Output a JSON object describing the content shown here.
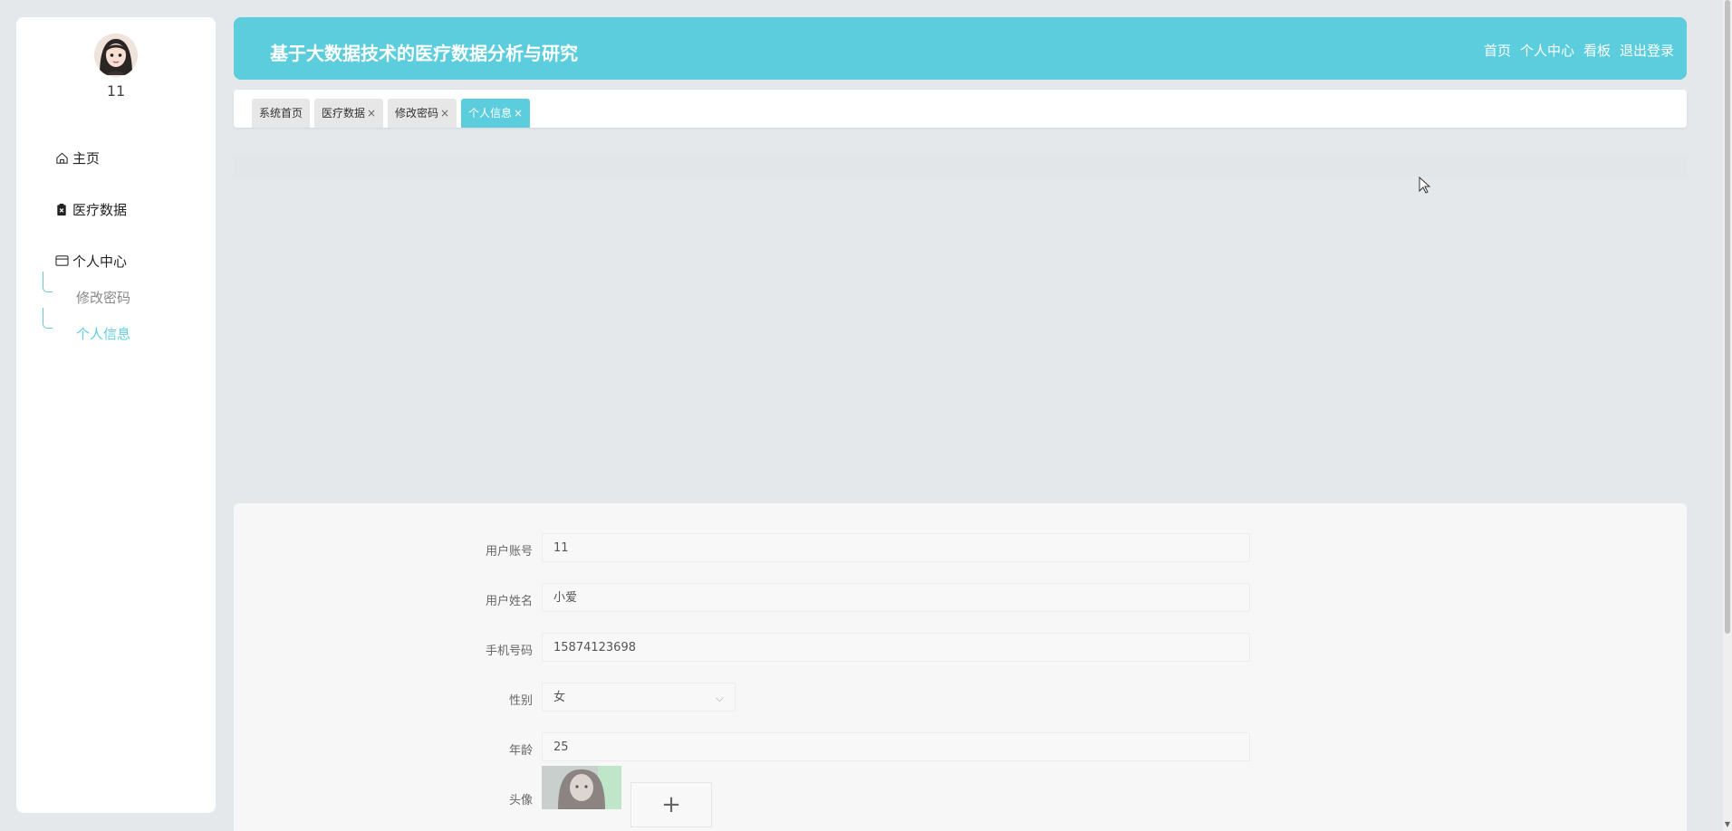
{
  "user": {
    "name": "11"
  },
  "sidebar": {
    "items": [
      {
        "label": "主页",
        "icon": "home-icon"
      },
      {
        "label": "医疗数据",
        "icon": "clipboard-icon"
      },
      {
        "label": "个人中心",
        "icon": "card-icon"
      }
    ],
    "subitems": [
      {
        "label": "修改密码"
      },
      {
        "label": "个人信息",
        "active": true
      }
    ]
  },
  "header": {
    "title": "基于大数据技术的医疗数据分析与研究",
    "nav": [
      "首页",
      "个人中心",
      "看板",
      "退出登录"
    ]
  },
  "tabs": [
    {
      "label": "系统首页",
      "closable": false
    },
    {
      "label": "医疗数据",
      "closable": true
    },
    {
      "label": "修改密码",
      "closable": true
    },
    {
      "label": "个人信息",
      "closable": true,
      "active": true
    }
  ],
  "close_glyph": "×",
  "form": {
    "account": {
      "label": "用户账号",
      "value": "11"
    },
    "name": {
      "label": "用户姓名",
      "value": "小爱"
    },
    "phone": {
      "label": "手机号码",
      "value": "15874123698"
    },
    "gender": {
      "label": "性别",
      "value": "女"
    },
    "age": {
      "label": "年龄",
      "value": "25"
    },
    "avatar": {
      "label": "头像",
      "upload_glyph": "+"
    }
  },
  "colors": {
    "accent": "#5bcddc",
    "background": "#e4e8eb"
  }
}
